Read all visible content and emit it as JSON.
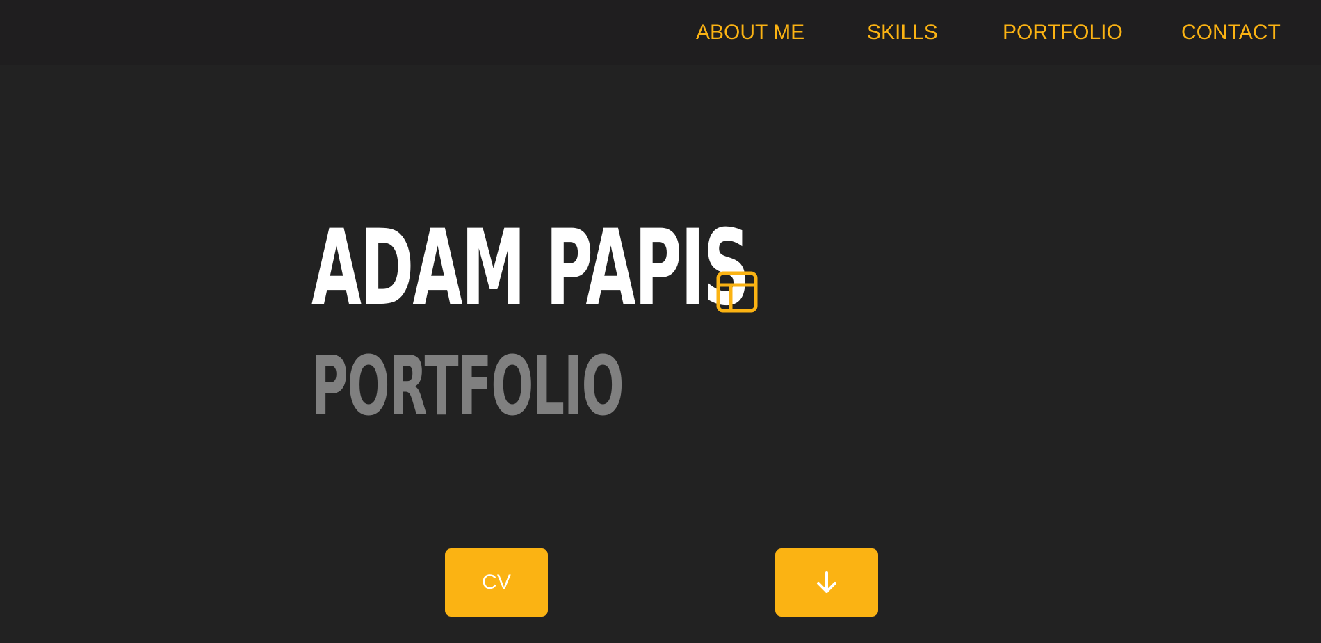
{
  "nav": {
    "items": [
      {
        "label": "ABOUT ME"
      },
      {
        "label": "SKILLS"
      },
      {
        "label": "PORTFOLIO"
      },
      {
        "label": "CONTACT"
      }
    ]
  },
  "hero": {
    "name": "ADAM PAPIS",
    "subtitle": "PORTFOLIO",
    "title_icon": "layout-icon"
  },
  "buttons": {
    "cv_label": "CV",
    "scroll_icon": "arrow-down-icon"
  },
  "colors": {
    "accent": "#fbb313",
    "background": "#222222",
    "navbar": "#1f1e1f",
    "title": "#ffffff",
    "subtitle": "#808080"
  }
}
